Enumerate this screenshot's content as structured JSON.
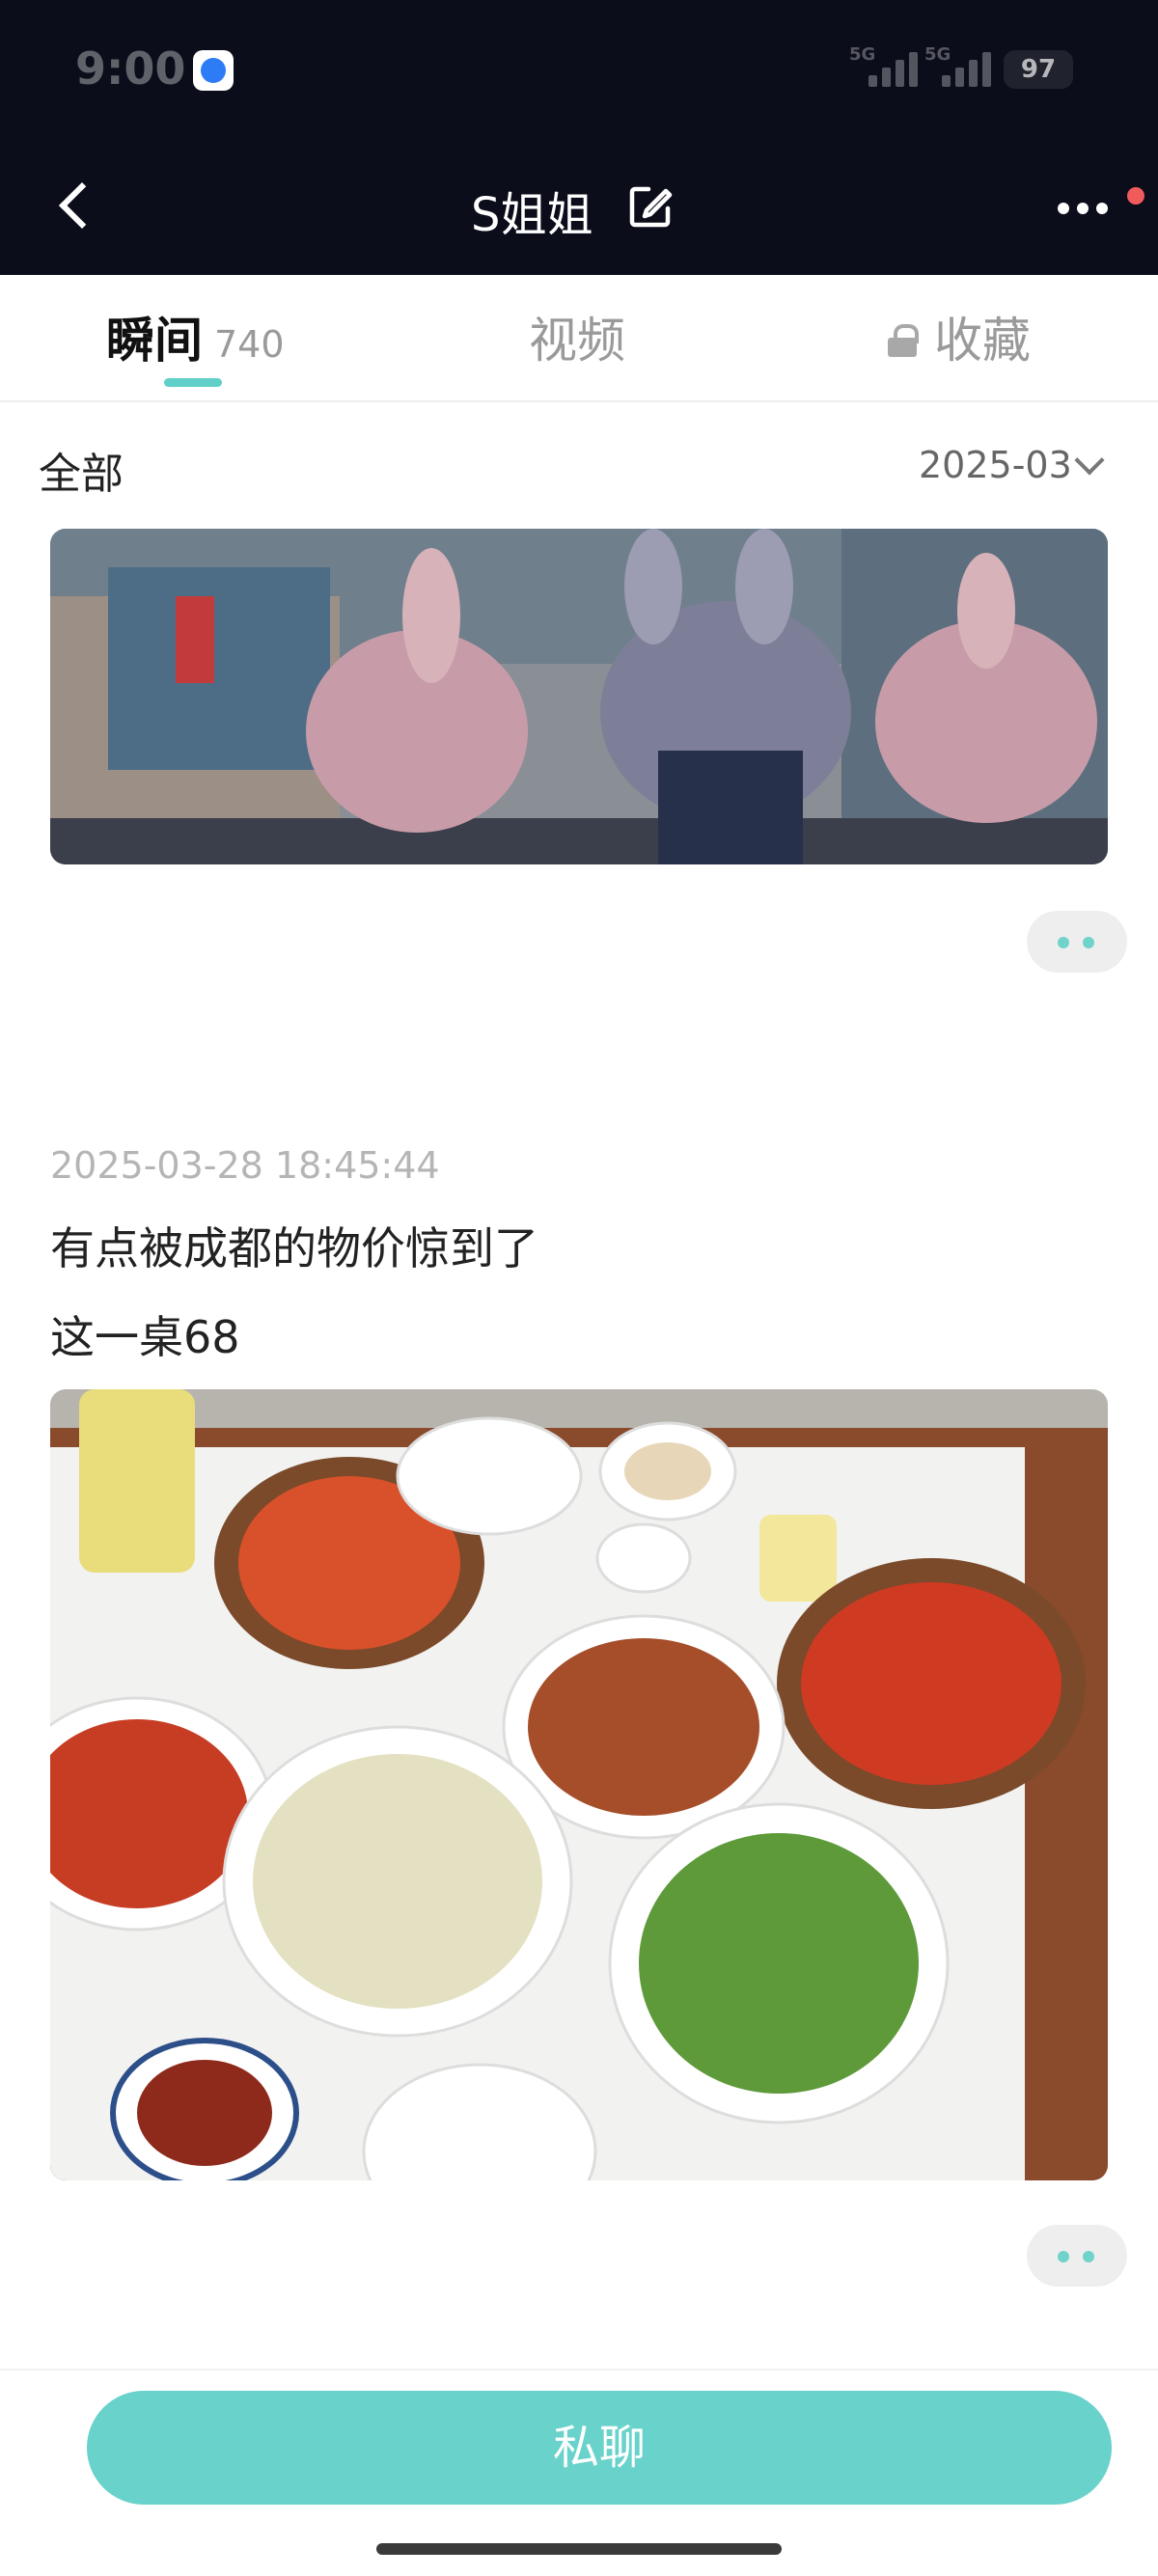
{
  "status_bar": {
    "time": "9:00",
    "network_1": "5G",
    "network_2": "5G",
    "battery": "97"
  },
  "nav": {
    "title": "S姐姐"
  },
  "tabs": [
    {
      "label": "瞬间",
      "count": "740"
    },
    {
      "label": "视频"
    },
    {
      "label": "收藏"
    }
  ],
  "filter": {
    "all_label": "全部",
    "month": "2025-03"
  },
  "posts": [
    {
      "timestamp": "2025-03-28 18:45:44",
      "text_lines": [
        "有点被成都的物价惊到了",
        "这一桌68"
      ]
    }
  ],
  "footer": {
    "chat_label": "私聊"
  },
  "colors": {
    "accent": "#68d2cb",
    "header_bg": "#0b0d1a",
    "notification_dot": "#f25b5b"
  },
  "icons": [
    "back-icon",
    "edit-icon",
    "more-icon",
    "lock-icon",
    "chevron-down-icon",
    "more-dots-icon"
  ]
}
